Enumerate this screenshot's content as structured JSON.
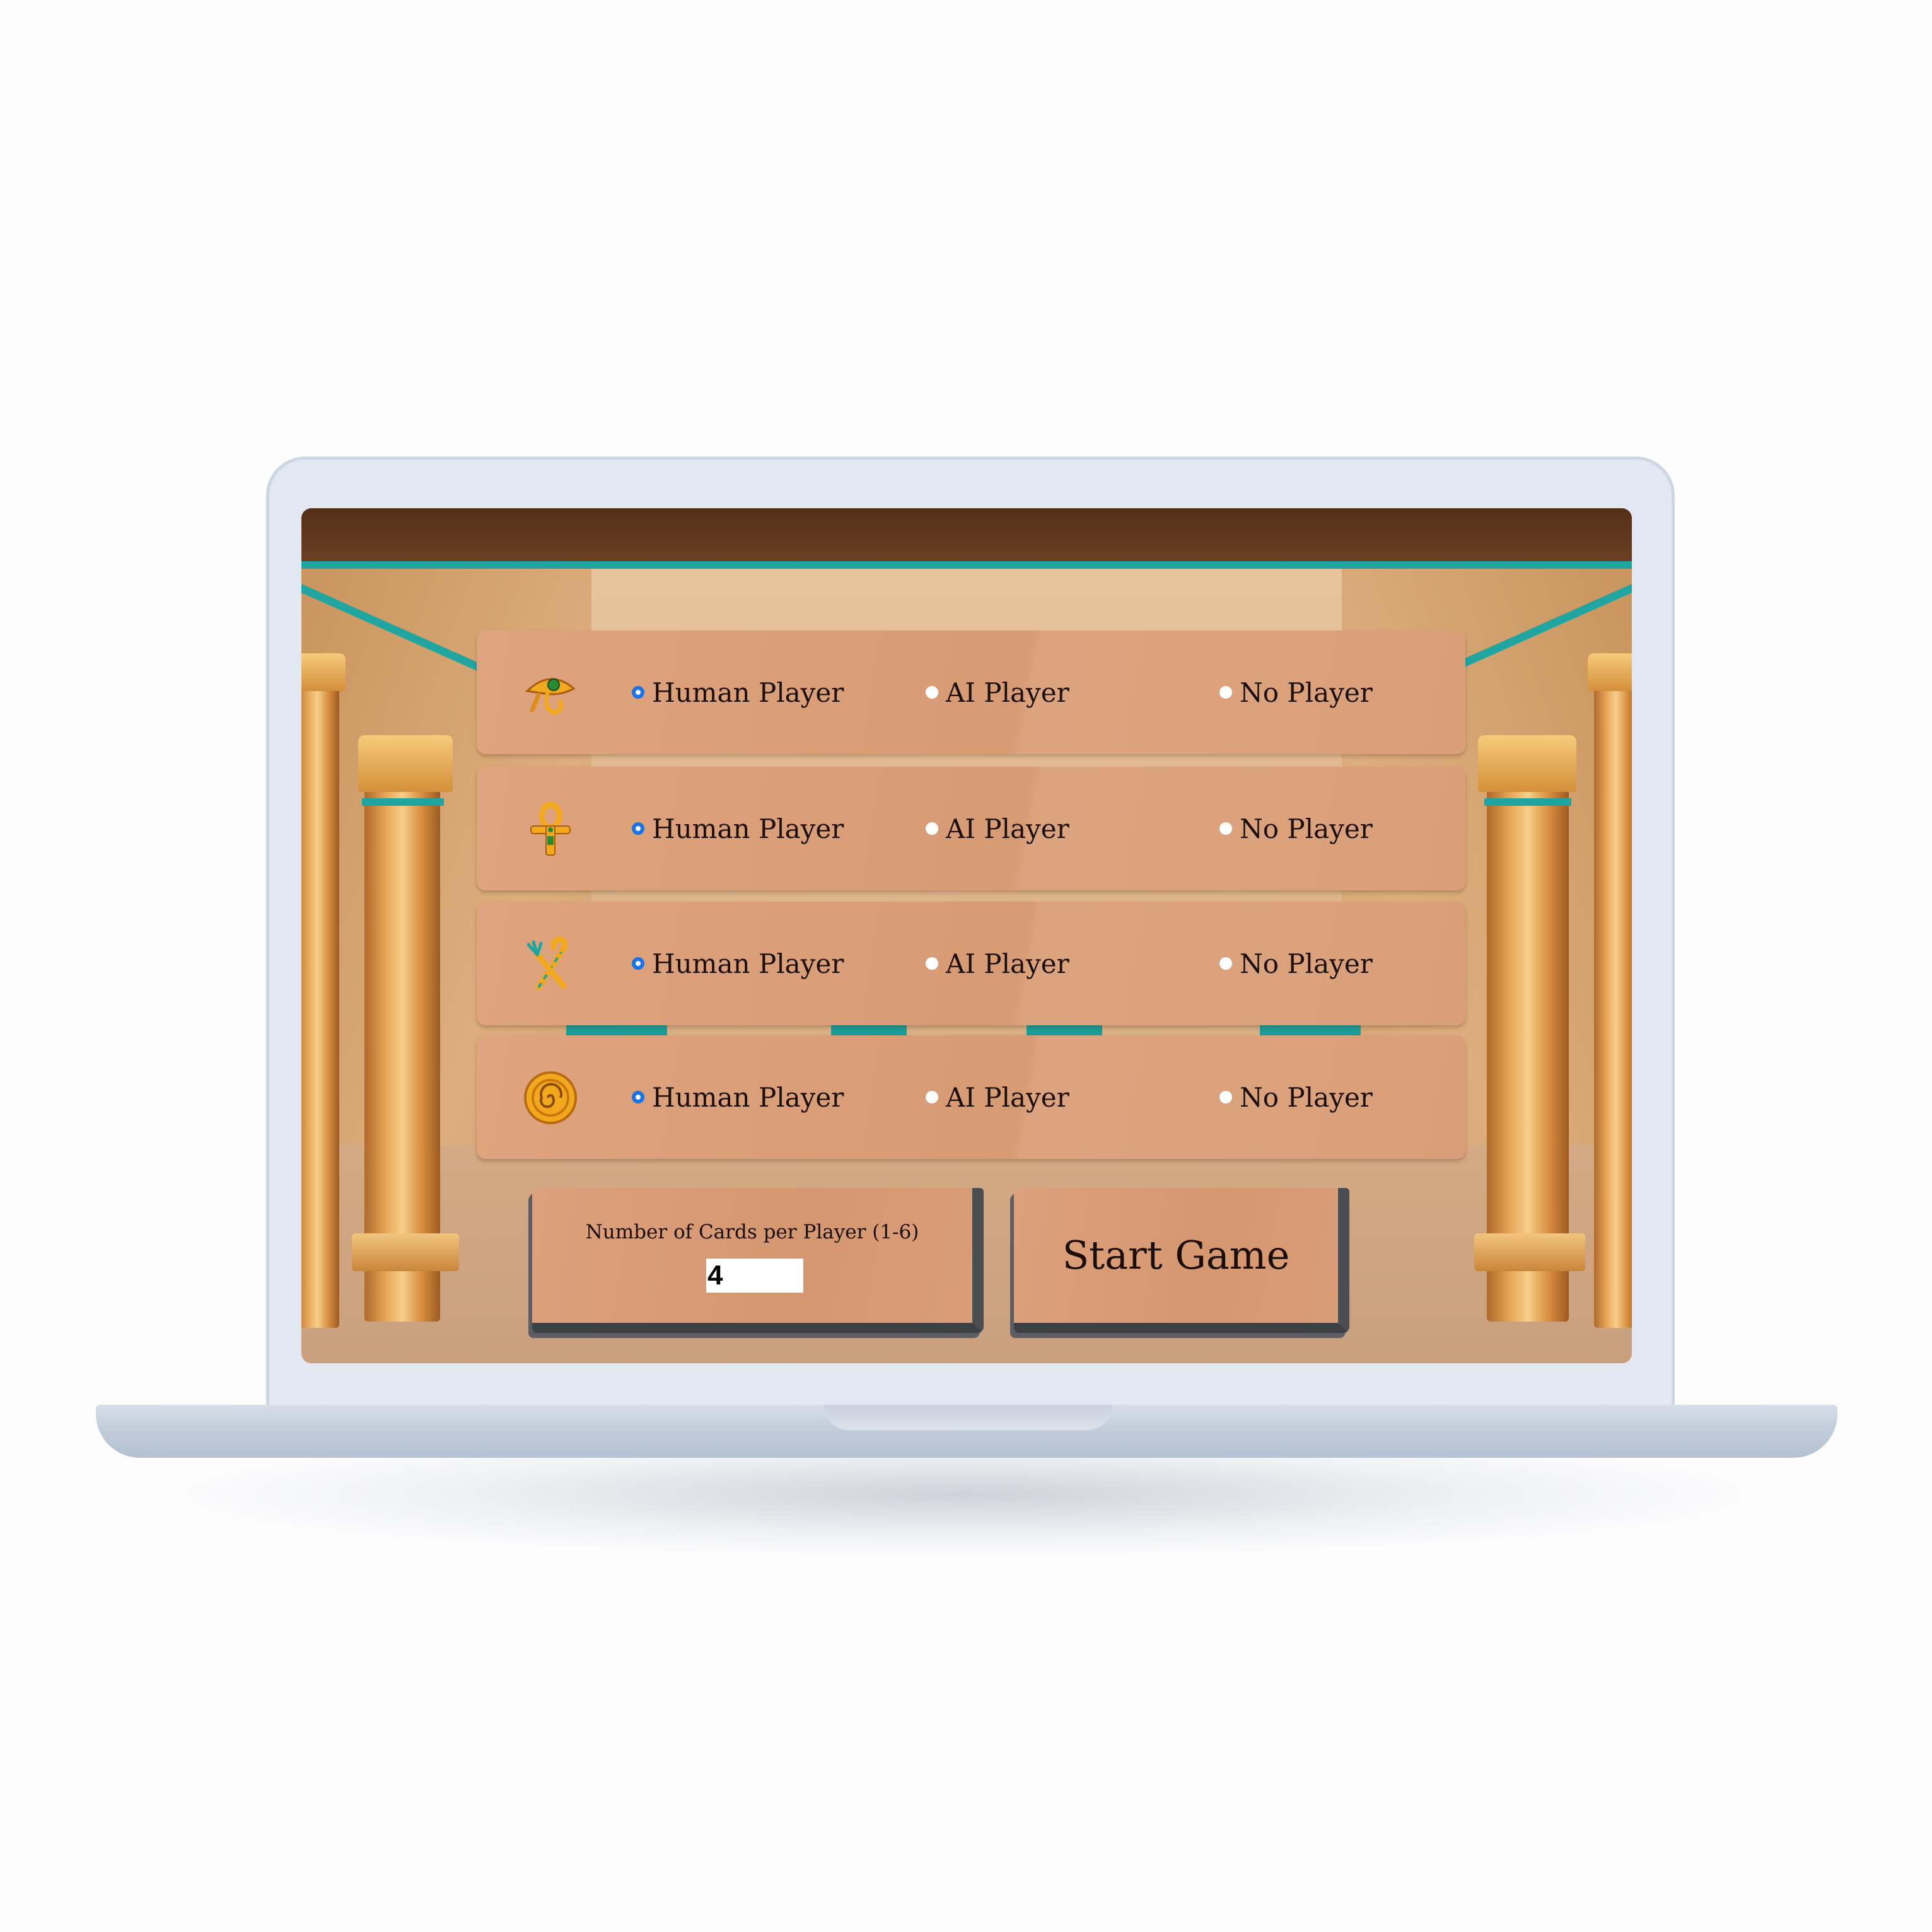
{
  "game": {
    "player_rows": [
      {
        "icon": "eye-of-horus-icon",
        "selected": "human",
        "options": {
          "human": "Human Player",
          "ai": "AI Player",
          "none": "No Player"
        }
      },
      {
        "icon": "ankh-icon",
        "selected": "human",
        "options": {
          "human": "Human Player",
          "ai": "AI Player",
          "none": "No Player"
        }
      },
      {
        "icon": "crook-and-flail-icon",
        "selected": "human",
        "options": {
          "human": "Human Player",
          "ai": "AI Player",
          "none": "No Player"
        }
      },
      {
        "icon": "gold-coin-icon",
        "selected": "human",
        "options": {
          "human": "Human Player",
          "ai": "AI Player",
          "none": "No Player"
        }
      }
    ],
    "cards_label": "Number of Cards per Player (1-6)",
    "cards_value": "4",
    "start_label": "Start Game"
  },
  "colors": {
    "radio_selected": "#1a73e8",
    "panel": "#d99f78",
    "stone_edge": "#3c3f44",
    "teal_accent": "#1fa4a0"
  }
}
